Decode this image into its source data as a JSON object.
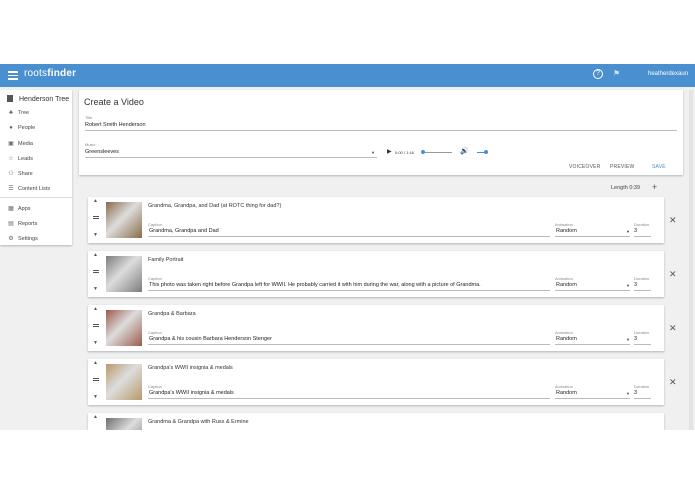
{
  "app": {
    "logo_light": "roots",
    "logo_bold": "finder",
    "user": "heatherdexaun"
  },
  "sidebar": {
    "title": "Henderson Tree",
    "items": [
      {
        "label": "Tree",
        "icon": "tree-icon"
      },
      {
        "label": "People",
        "icon": "person-icon"
      },
      {
        "label": "Media",
        "icon": "image-icon"
      },
      {
        "label": "Leads",
        "icon": "star-icon"
      },
      {
        "label": "Share",
        "icon": "share-icon"
      },
      {
        "label": "Content Lists",
        "icon": "list-icon"
      },
      {
        "label": "Apps",
        "icon": "apps-icon"
      },
      {
        "label": "Reports",
        "icon": "reports-icon"
      },
      {
        "label": "Settings",
        "icon": "gear-icon"
      }
    ]
  },
  "editor": {
    "heading": "Create a Video",
    "title_label": "Title",
    "title_value": "Robert Smith Henderson",
    "music_label": "Music",
    "music_value": "Greensleeves",
    "time": "0:00 / 1:16",
    "progress": 0.0,
    "volume": 0.9,
    "buttons": {
      "voiceover": "VOICEOVER",
      "preview": "PREVIEW",
      "save": "SAVE"
    }
  },
  "length_label": "Length 0:39",
  "slides": [
    {
      "title": "Grandma, Grandpa, and Dad (at ROTC thing for dad?)",
      "caption_label": "Caption",
      "caption": "Grandma, Grandpa and Dad",
      "animation_label": "Animation",
      "animation": "Random",
      "duration_label": "Duration",
      "duration": "3",
      "thumb": "#8a6b4a"
    },
    {
      "title": "Family Portrait",
      "caption_label": "Caption",
      "caption": "This photo was taken right before Grandpa left for WWII. He probably carried it with him during the war, along with a picture of Grandma.",
      "animation_label": "Animation",
      "animation": "Random",
      "duration_label": "Duration",
      "duration": "3",
      "thumb": "#7c7c7c"
    },
    {
      "title": "Grandpa & Barbara",
      "caption_label": "Caption",
      "caption": "Grandpa & his cousin Barbara Henderson Stenger",
      "animation_label": "Animation",
      "animation": "Random",
      "duration_label": "Duration",
      "duration": "3",
      "thumb": "#9b5a4a"
    },
    {
      "title": "Grandpa's WWII insignia & medals",
      "caption_label": "Caption",
      "caption": "Grandpa's WWII insignia & medals",
      "animation_label": "Animation",
      "animation": "Random",
      "duration_label": "Duration",
      "duration": "3",
      "thumb": "#b89a6a"
    },
    {
      "title": "Grandma & Grandpa with Russ & Ermine",
      "caption_label": "",
      "caption": "",
      "animation_label": "",
      "animation": "",
      "duration_label": "",
      "duration": "",
      "thumb": "#6e6e6e"
    }
  ]
}
